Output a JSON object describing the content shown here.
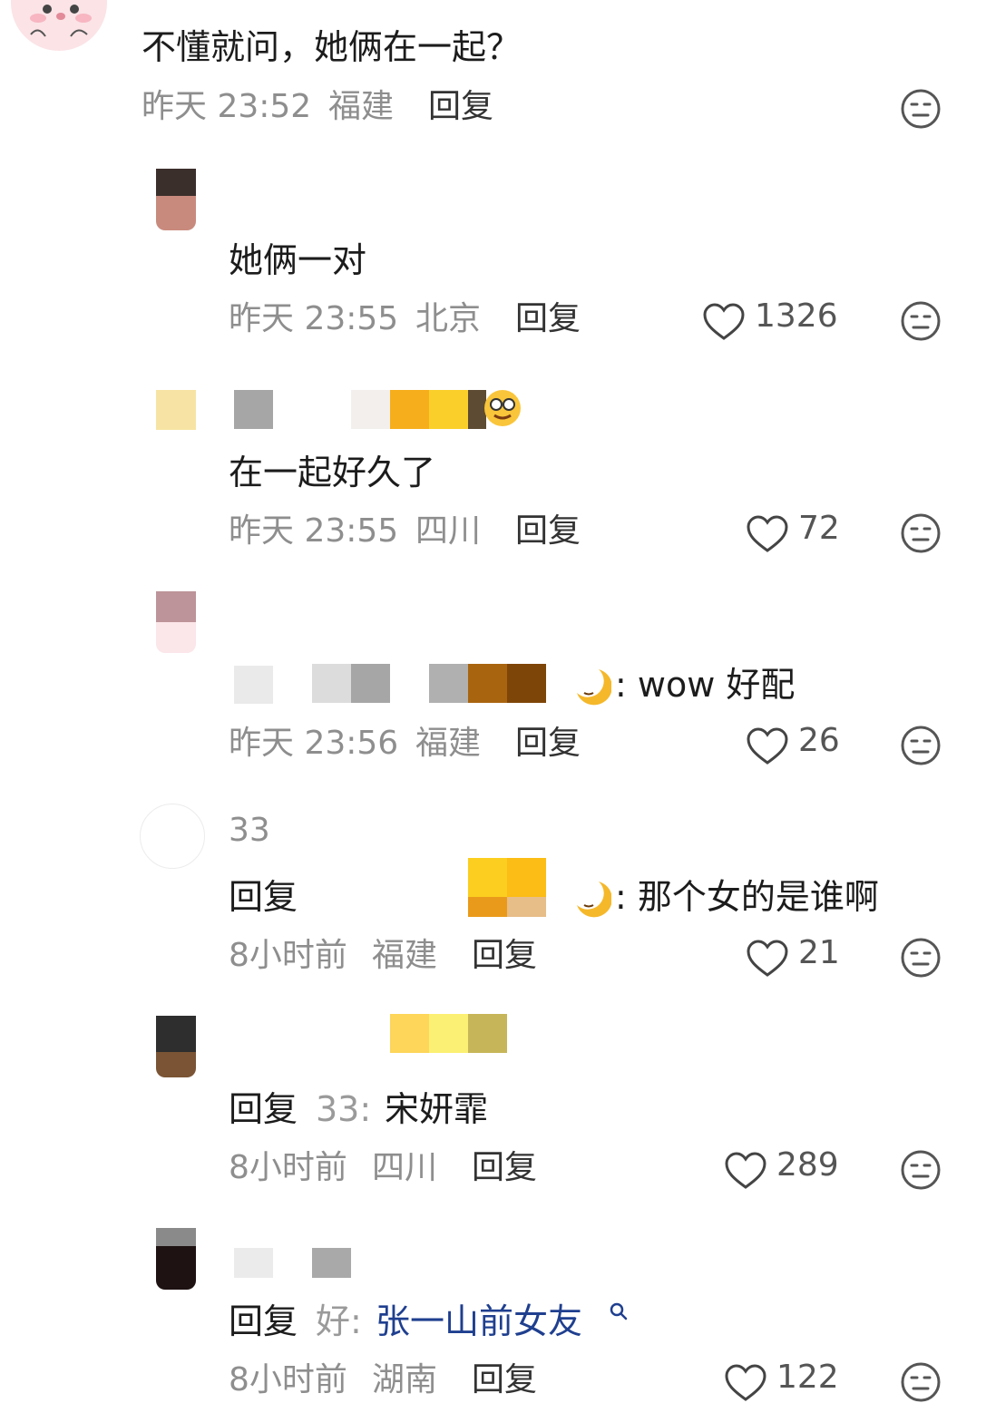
{
  "colors": {
    "text": "#1c1c1c",
    "meta": "#8e8e8e",
    "link": "#1f3f8f",
    "icon": "#555555"
  },
  "comments": [
    {
      "text": "不懂就问，她俩在一起？",
      "time": "昨天 23:52",
      "region": "福建",
      "reply_label": "回复"
    },
    {
      "text": "她俩一对",
      "time": "昨天 23:55",
      "region": "北京",
      "reply_label": "回复",
      "likes": "1326"
    },
    {
      "text": "在一起好久了",
      "time": "昨天 23:55",
      "region": "四川",
      "reply_label": "回复",
      "likes": "72"
    },
    {
      "text": ": wow 好配",
      "time": "昨天 23:56",
      "region": "福建",
      "reply_label": "回复",
      "likes": "26"
    },
    {
      "username": "33",
      "reply_prefix": "回复",
      "text": ": 那个女的是谁啊",
      "time": "8小时前",
      "region": "福建",
      "reply_label": "回复",
      "likes": "21"
    },
    {
      "reply_prefix": "回复",
      "reply_target": "33:",
      "text": "宋妍霏",
      "time": "8小时前",
      "region": "四川",
      "reply_label": "回复",
      "likes": "289"
    },
    {
      "reply_prefix": "回复",
      "reply_target": "好:",
      "text": "张一山前女友",
      "time": "8小时前",
      "region": "湖南",
      "reply_label": "回复",
      "likes": "122"
    }
  ],
  "icons": {
    "dislike": "neutral-face-icon",
    "like": "heart-outline-icon",
    "search": "search-icon"
  }
}
